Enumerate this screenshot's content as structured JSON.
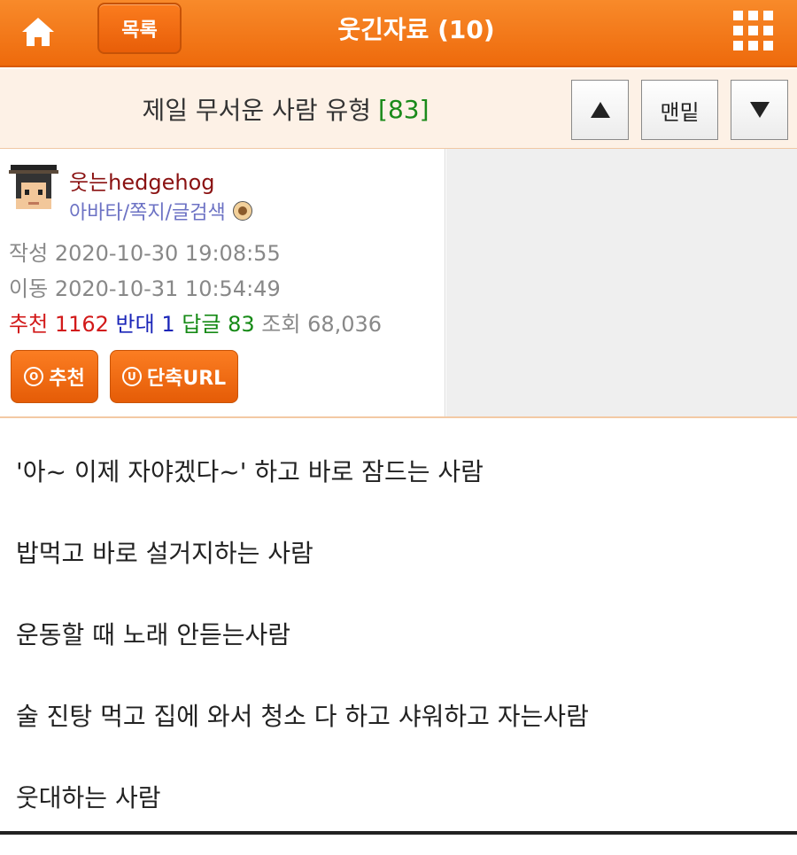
{
  "header": {
    "home_icon": "home-icon",
    "list_label": "목록",
    "board_title": "웃긴자료 (10)",
    "menu_icon": "grid-menu-icon",
    "accent_color": "#f07214"
  },
  "post": {
    "title": "제일 무서운 사람 유형",
    "comment_count": "[83]",
    "nav_up_icon": "arrow-up-icon",
    "nav_bottom_label": "맨밑",
    "nav_down_icon": "arrow-down-icon"
  },
  "author": {
    "nickname": "웃는hedgehog",
    "links": "아바타/쪽지/글검색",
    "written_label": "작성",
    "written_date": "2020-10-30 19:08:55",
    "moved_label": "이동",
    "moved_date": "2020-10-31 10:54:49"
  },
  "stats": {
    "recommend_label": "추천",
    "recommend_value": "1162",
    "oppose_label": "반대",
    "oppose_value": "1",
    "reply_label": "답글",
    "reply_value": "83",
    "view_label": "조회",
    "view_value": "68,036"
  },
  "actions": {
    "recommend_button": "추천",
    "recommend_icon_text": "O",
    "short_url_button": "단축URL",
    "short_url_icon_text": "U"
  },
  "content": {
    "lines": [
      "'아~ 이제 자야겠다~' 하고 바로 잠드는 사람",
      "밥먹고 바로 설거지하는 사람",
      "운동할 때 노래 안듣는사람",
      "술 진탕 먹고 집에 와서 청소 다 하고 샤워하고 자는사람",
      "웃대하는 사람"
    ]
  }
}
